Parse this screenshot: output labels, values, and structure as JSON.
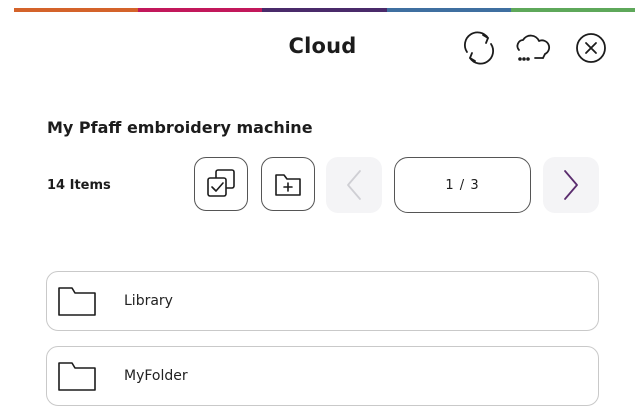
{
  "accent_colors": [
    "#d4632a",
    "#c2185b",
    "#4a2a6a",
    "#3f6fa0",
    "#5ea85a"
  ],
  "header": {
    "title": "Cloud",
    "icons": [
      "sync-icon",
      "cloud-icon",
      "close-icon"
    ]
  },
  "section": {
    "title": "My Pfaff embroidery machine",
    "count_label": "14 Items"
  },
  "toolbar": {
    "icons": [
      "select-all-icon",
      "new-folder-icon",
      "chevron-left-icon",
      "chevron-right-icon"
    ],
    "prev_enabled": false,
    "next_enabled": true
  },
  "pagination": {
    "label": "1 / 3"
  },
  "items": [
    {
      "label": "Library",
      "icon": "folder-icon"
    },
    {
      "label": "MyFolder",
      "icon": "folder-icon"
    }
  ]
}
